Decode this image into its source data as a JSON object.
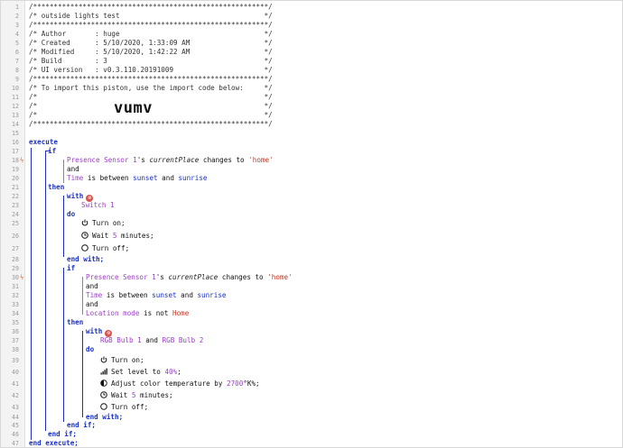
{
  "header": [
    "/*********************************************************/",
    "/* outside lights test                                   */",
    "/*********************************************************/",
    "/* Author       : huge                                   */",
    "/* Created      : 5/10/2020, 1:33:09 AM                  */",
    "/* Modified     : 5/10/2020, 1:42:22 AM                  */",
    "/* Build        : 3                                      */",
    "/* UI version   : v0.3.110.20191009                      */",
    "/*********************************************************/",
    "/* To import this piston, use the import code below:     */",
    "/*                                                       */",
    "/*                                                       */",
    "/*                                                       */",
    "/*********************************************************/"
  ],
  "import_code": "vumv",
  "keywords": {
    "execute": "execute",
    "if": "if",
    "and": "and",
    "then": "then",
    "with": "with",
    "do": "do",
    "end_with": "end with;",
    "end_if": "end if;",
    "end_execute": "end execute;"
  },
  "conditions": {
    "presence_device": "Presence Sensor 1",
    "presence_attr": "currentPlace",
    "presence_mid": "'s ",
    "changes_to": " changes to ",
    "home_str": "'home'",
    "time": "Time",
    "between": " is between ",
    "sunset": "sunset",
    "sunrise": "sunrise",
    "and_word": " and ",
    "location_mode": "Location mode",
    "is_not": " is not ",
    "home_val": "Home"
  },
  "block1": {
    "device": "Switch 1",
    "actions": [
      {
        "icon": "power-icon",
        "text": "Turn on;"
      },
      {
        "icon": "clock-icon",
        "text_pre": "Wait ",
        "value": "5",
        "text_post": " minutes;"
      },
      {
        "icon": "power-off-icon",
        "text": "Turn off;"
      }
    ]
  },
  "block2": {
    "device_a": "RGB Bulb 1",
    "device_b": "RGB Bulb 2",
    "actions": {
      "turn_on": "Turn on;",
      "level_pre": "Set level to ",
      "level_val": "40%",
      "level_post": ";",
      "temp_pre": "Adjust color temperature by ",
      "temp_val": "2700",
      "temp_post": "°K%;",
      "wait_pre": "Wait ",
      "wait_val": "5",
      "wait_post": " minutes;",
      "turn_off": "Turn off;"
    }
  },
  "line_count": 47,
  "flagged_lines": [
    18,
    30
  ],
  "colors": {
    "keyword": "#1a2fbf",
    "variable": "#9b41c8",
    "string": "#c0392b",
    "flag": "#e46b2b"
  }
}
